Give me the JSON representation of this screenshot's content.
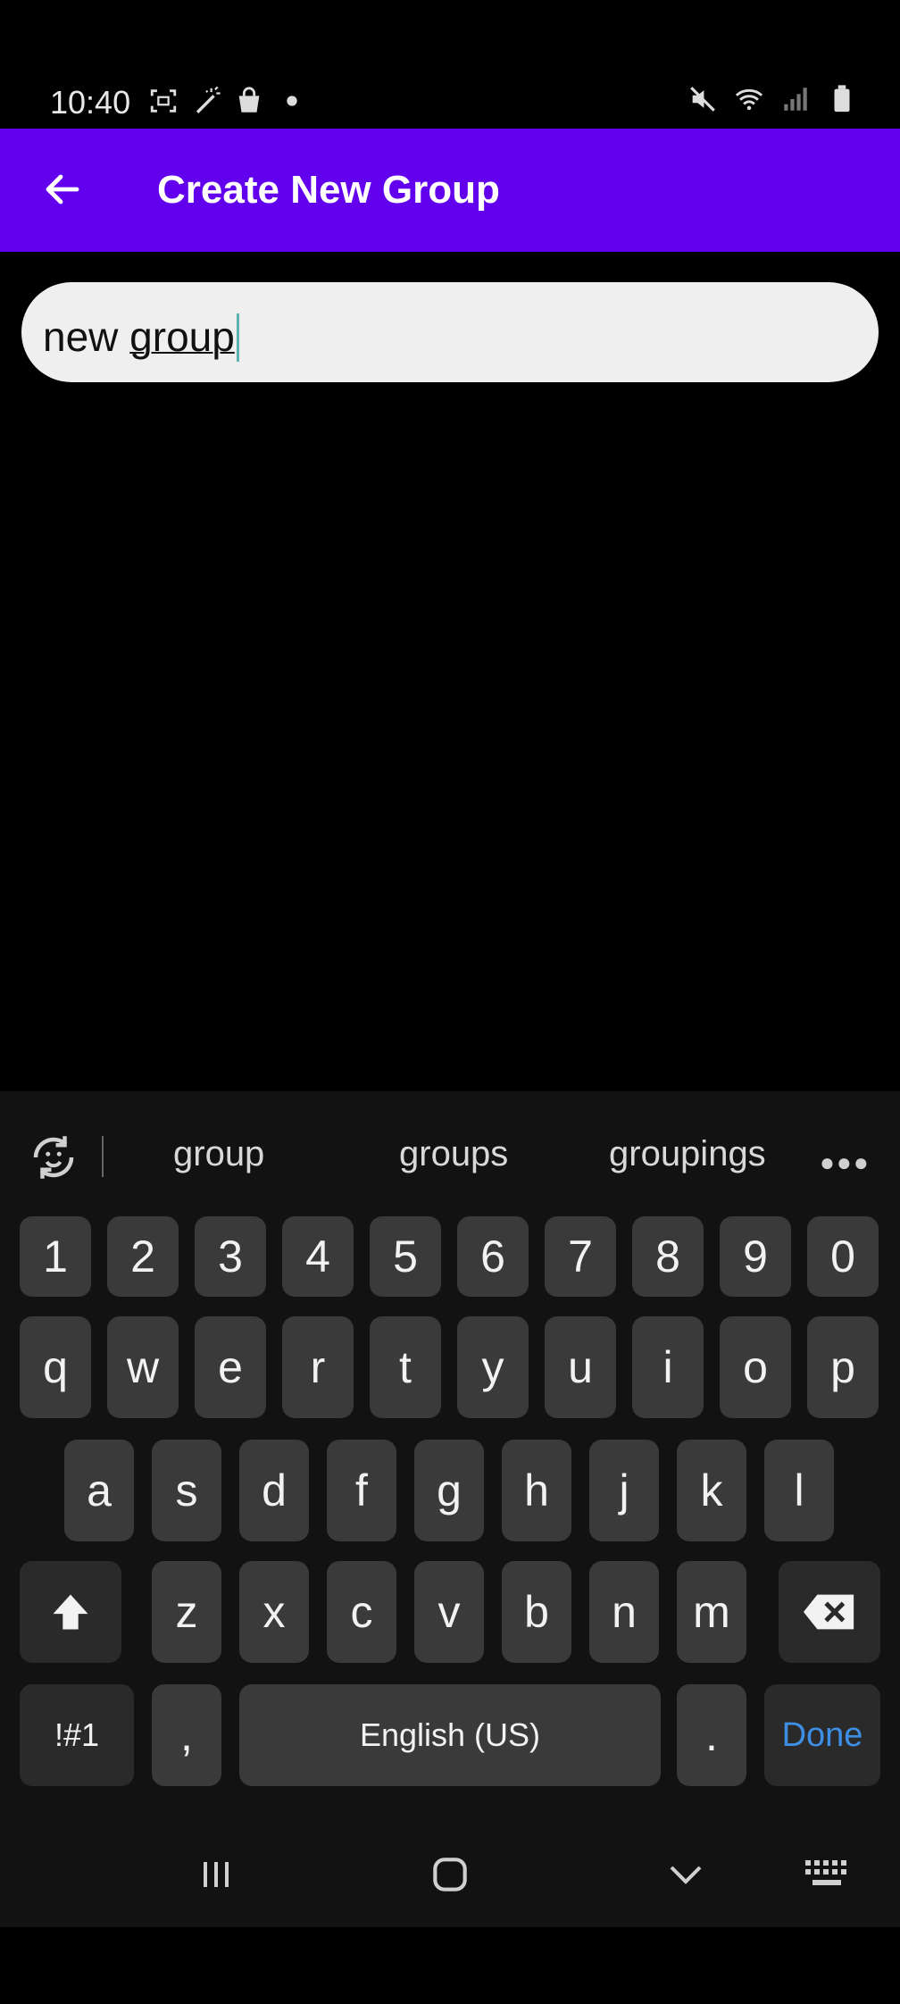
{
  "status_bar": {
    "time": "10:40",
    "left_icons": [
      "screenshot-icon",
      "magic-wand-icon",
      "shopping-bag-icon",
      "dot-icon"
    ],
    "right_icons": [
      "mute-icon",
      "wifi-icon",
      "signal-icon",
      "battery-icon"
    ]
  },
  "app_bar": {
    "title": "Create New Group",
    "back_icon": "arrow-left-icon",
    "color": "#6200ee"
  },
  "group_name_input": {
    "value_prefix": "new ",
    "value_composing": "group"
  },
  "keyboard": {
    "suggestions": [
      "group",
      "groups",
      "groupings"
    ],
    "number_row": [
      "1",
      "2",
      "3",
      "4",
      "5",
      "6",
      "7",
      "8",
      "9",
      "0"
    ],
    "row1": [
      "q",
      "w",
      "e",
      "r",
      "t",
      "y",
      "u",
      "i",
      "o",
      "p"
    ],
    "row2": [
      "a",
      "s",
      "d",
      "f",
      "g",
      "h",
      "j",
      "k",
      "l"
    ],
    "row3": [
      "z",
      "x",
      "c",
      "v",
      "b",
      "n",
      "m"
    ],
    "symbols_label": "!#1",
    "comma_label": ",",
    "space_label": "English (US)",
    "period_label": ".",
    "done_label": "Done",
    "done_color": "#3d8fe6"
  },
  "nav_bar": {
    "icons": [
      "recent-apps-icon",
      "home-icon",
      "back-chevron-icon",
      "keyboard-icon"
    ]
  }
}
